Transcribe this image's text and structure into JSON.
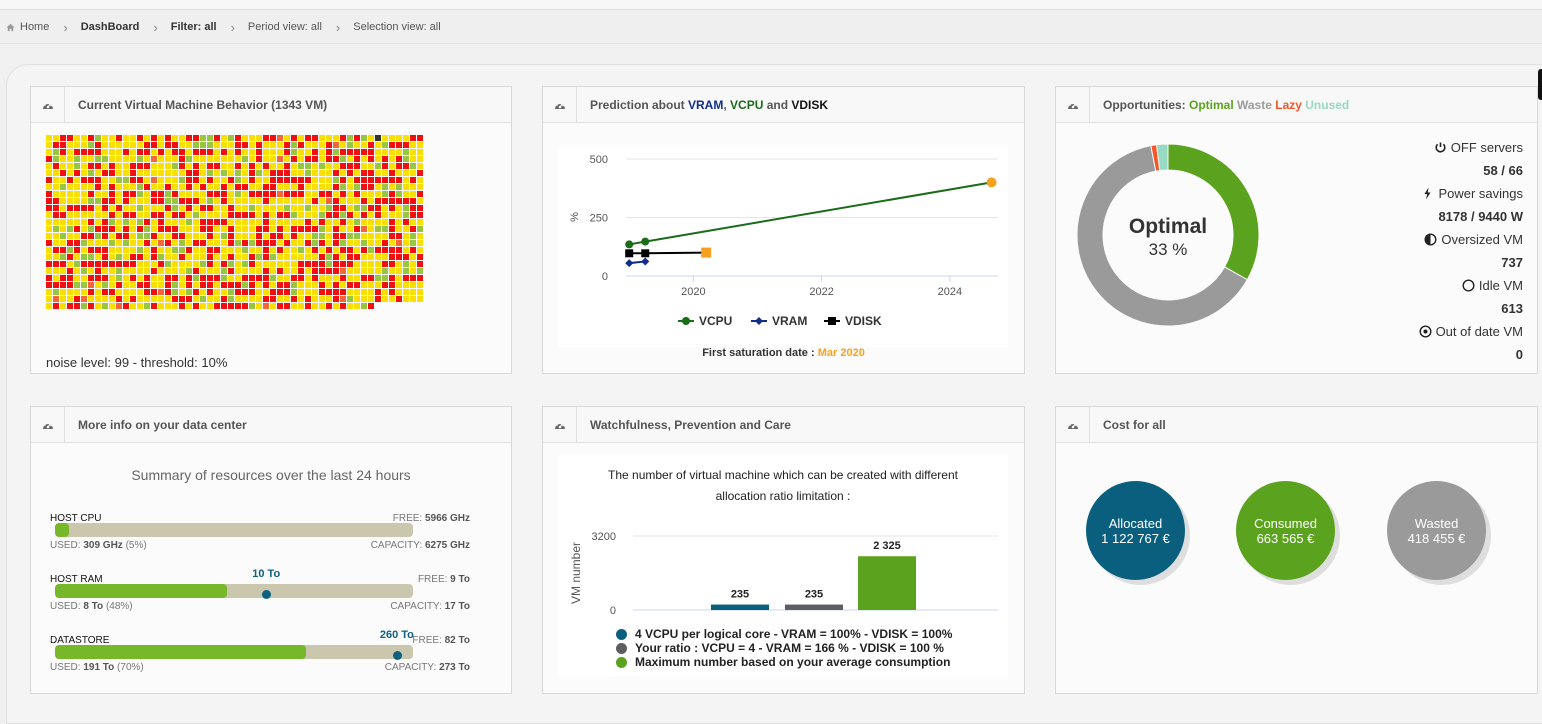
{
  "breadcrumb": [
    {
      "label": "Home",
      "icon": "home-icon"
    },
    {
      "label": "DashBoard"
    },
    {
      "label": "Filter: all"
    },
    {
      "label": "Period view: all"
    },
    {
      "label": "Selection view: all"
    }
  ],
  "panels": {
    "vm_behavior": {
      "title": "Current Virtual Machine Behavior (1343 VM)",
      "vm_count": 1343,
      "noise_text": "noise level: 99 - threshold: 10%",
      "colors": {
        "high": "#f20f0f",
        "normal": "#fbdf00",
        "low": "#98c640",
        "warn": "#f5673a",
        "off": "#333333"
      }
    },
    "prediction": {
      "title_prefix": "Prediction about ",
      "title_vram": "VRAM",
      "title_comma": ", ",
      "title_vcpu": "VCPU",
      "title_and": " and ",
      "title_vdisk": "VDISK",
      "saturation_label": "First saturation date : ",
      "saturation_date": "Mar 2020"
    },
    "opportunities": {
      "title_prefix": "Opportunities: ",
      "legend": [
        {
          "label": "Optimal",
          "color": "#5ba21e"
        },
        {
          "label": "Waste",
          "color": "#9a9a9a"
        },
        {
          "label": "Lazy",
          "color": "#f5572a"
        },
        {
          "label": "Unused",
          "color": "#97d9c3"
        }
      ],
      "center_label": "Optimal",
      "center_value": "33 %",
      "stats": [
        {
          "icon": "power-icon",
          "label": "OFF servers",
          "value": "58 / 66"
        },
        {
          "icon": "bolt-icon",
          "label": "Power savings",
          "value": "8178 / 9440 W"
        },
        {
          "icon": "half-circle-icon",
          "label": "Oversized VM",
          "value": "737"
        },
        {
          "icon": "circle-icon",
          "label": "Idle VM",
          "value": "613"
        },
        {
          "icon": "dot-circle-icon",
          "label": "Out of date VM",
          "value": "0"
        }
      ]
    },
    "datacenter": {
      "title": "More info on your data center",
      "summary": "Summary of resources over the last 24 hours",
      "resources": [
        {
          "name": "HOST CPU",
          "free_label": "FREE: ",
          "free": "5966 GHz",
          "used_label": "USED: ",
          "used": "309 GHz",
          "used_pct_text": " (5%)",
          "used_fraction": 0.05,
          "cap_label": "CAPACITY: ",
          "capacity": "6275 GHz"
        },
        {
          "name": "HOST RAM",
          "free_label": "FREE: ",
          "free": "9 To",
          "used_label": "USED: ",
          "used": "8 To",
          "used_pct_text": " (48%)",
          "used_fraction": 0.48,
          "cap_label": "CAPACITY: ",
          "capacity": "17 To",
          "marker_label": "10 To",
          "marker_fraction": 0.59
        },
        {
          "name": "DATASTORE",
          "free_label": "FREE: ",
          "free": "82 To",
          "used_label": "USED: ",
          "used": "191 To",
          "used_pct_text": " (70%)",
          "used_fraction": 0.7,
          "cap_label": "CAPACITY: ",
          "capacity": "273 To",
          "marker_label": "260 To",
          "marker_fraction": 0.955
        }
      ]
    },
    "watchfulness": {
      "title": "Watchfulness, Prevention and Care",
      "chart_title_line1": "The number of virtual machine which can be created with different",
      "chart_title_line2": "allocation ratio limitation :"
    },
    "cost": {
      "title": "Cost for all",
      "items": [
        {
          "label": "Allocated",
          "value": "1 122 767 €",
          "color": "#0b5f7e"
        },
        {
          "label": "Consumed",
          "value": "663 565 €",
          "color": "#5ba21e"
        },
        {
          "label": "Wasted",
          "value": "418 455 €",
          "color": "#9a9a9a"
        }
      ]
    }
  },
  "chart_data": [
    {
      "type": "line",
      "title": "Prediction about VRAM, VCPU and VDISK",
      "xlabel": "",
      "ylabel": "%",
      "xlim": [
        2018.95,
        2024.75
      ],
      "ylim": [
        0,
        500
      ],
      "yticks": [
        0,
        250,
        500
      ],
      "xticks": [
        2020,
        2022,
        2024
      ],
      "grid": true,
      "legend": "bottom",
      "series": [
        {
          "name": "VCPU",
          "color": "#1a6b1a",
          "marker": "circle",
          "x": [
            2019.0,
            2019.25
          ],
          "y": [
            135,
            147
          ],
          "projection": {
            "x": [
              2019.25,
              2024.65
            ],
            "y": [
              147,
              400
            ]
          },
          "saturation_point": {
            "x": 2024.65,
            "y": 400
          }
        },
        {
          "name": "VRAM",
          "color": "#102e8a",
          "marker": "diamond",
          "x": [
            2019.0,
            2019.25
          ],
          "y": [
            55,
            62
          ]
        },
        {
          "name": "VDISK",
          "color": "#000000",
          "marker": "square",
          "x": [
            2019.0,
            2019.25
          ],
          "y": [
            97,
            97
          ],
          "projection": {
            "x": [
              2019.25,
              2020.2
            ],
            "y": [
              97,
              100
            ]
          },
          "saturation_point": {
            "x": 2020.2,
            "y": 100
          }
        }
      ],
      "saturation_color": "#f7a21c"
    },
    {
      "type": "pie",
      "title": "Opportunities",
      "donut": true,
      "slices": [
        {
          "label": "Optimal",
          "value": 33,
          "color": "#5ba21e"
        },
        {
          "label": "Waste",
          "value": 63.5,
          "color": "#9a9a9a"
        },
        {
          "label": "Lazy",
          "value": 1,
          "color": "#f5572a"
        },
        {
          "label": "Unused",
          "value": 2,
          "color": "#97d9c3"
        }
      ]
    },
    {
      "type": "bar",
      "title": "The number of virtual machine which can be created with different allocation ratio limitation :",
      "xlabel": "",
      "ylabel": "VM number",
      "ylim": [
        0,
        3200
      ],
      "yticks": [
        0,
        3200
      ],
      "grid": true,
      "legend": "bottom",
      "series": [
        {
          "name": "4 VCPU per logical core - VRAM = 100% - VDISK = 100%",
          "value": 235,
          "label": "235",
          "color": "#0b5f7e"
        },
        {
          "name": "Your ratio : VCPU = 4 - VRAM = 166 % - VDISK = 100 %",
          "value": 235,
          "label": "235",
          "color": "#5d5d62"
        },
        {
          "name": "Maximum number based on your average consumption",
          "value": 2325,
          "label": "2 325",
          "color": "#5ba21e"
        }
      ]
    }
  ]
}
